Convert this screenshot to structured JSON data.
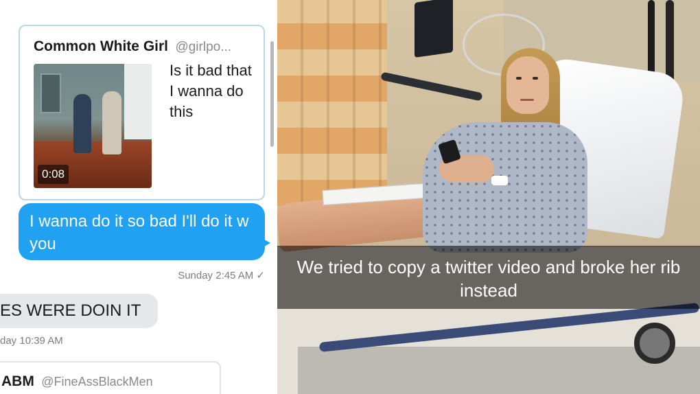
{
  "chat": {
    "tweet1": {
      "name": "Common White Girl",
      "handle": "@girlpo...",
      "text": "Is it bad that I wanna do this",
      "video_duration": "0:08"
    },
    "sent_message": {
      "text": "I wanna do it so bad I'll do it w you",
      "meta": "Sunday 2:45 AM ✓"
    },
    "received_message": {
      "text": "ES WERE DOIN IT",
      "meta": "day 10:39 AM"
    },
    "tweet2": {
      "name": "ABM",
      "handle": "@FineAssBlackMen"
    },
    "colors": {
      "sent_bubble": "#21a1f1",
      "received_bubble": "#e6e7eb"
    }
  },
  "photo": {
    "caption": "We tried to copy a twitter video and broke her rib instead"
  }
}
